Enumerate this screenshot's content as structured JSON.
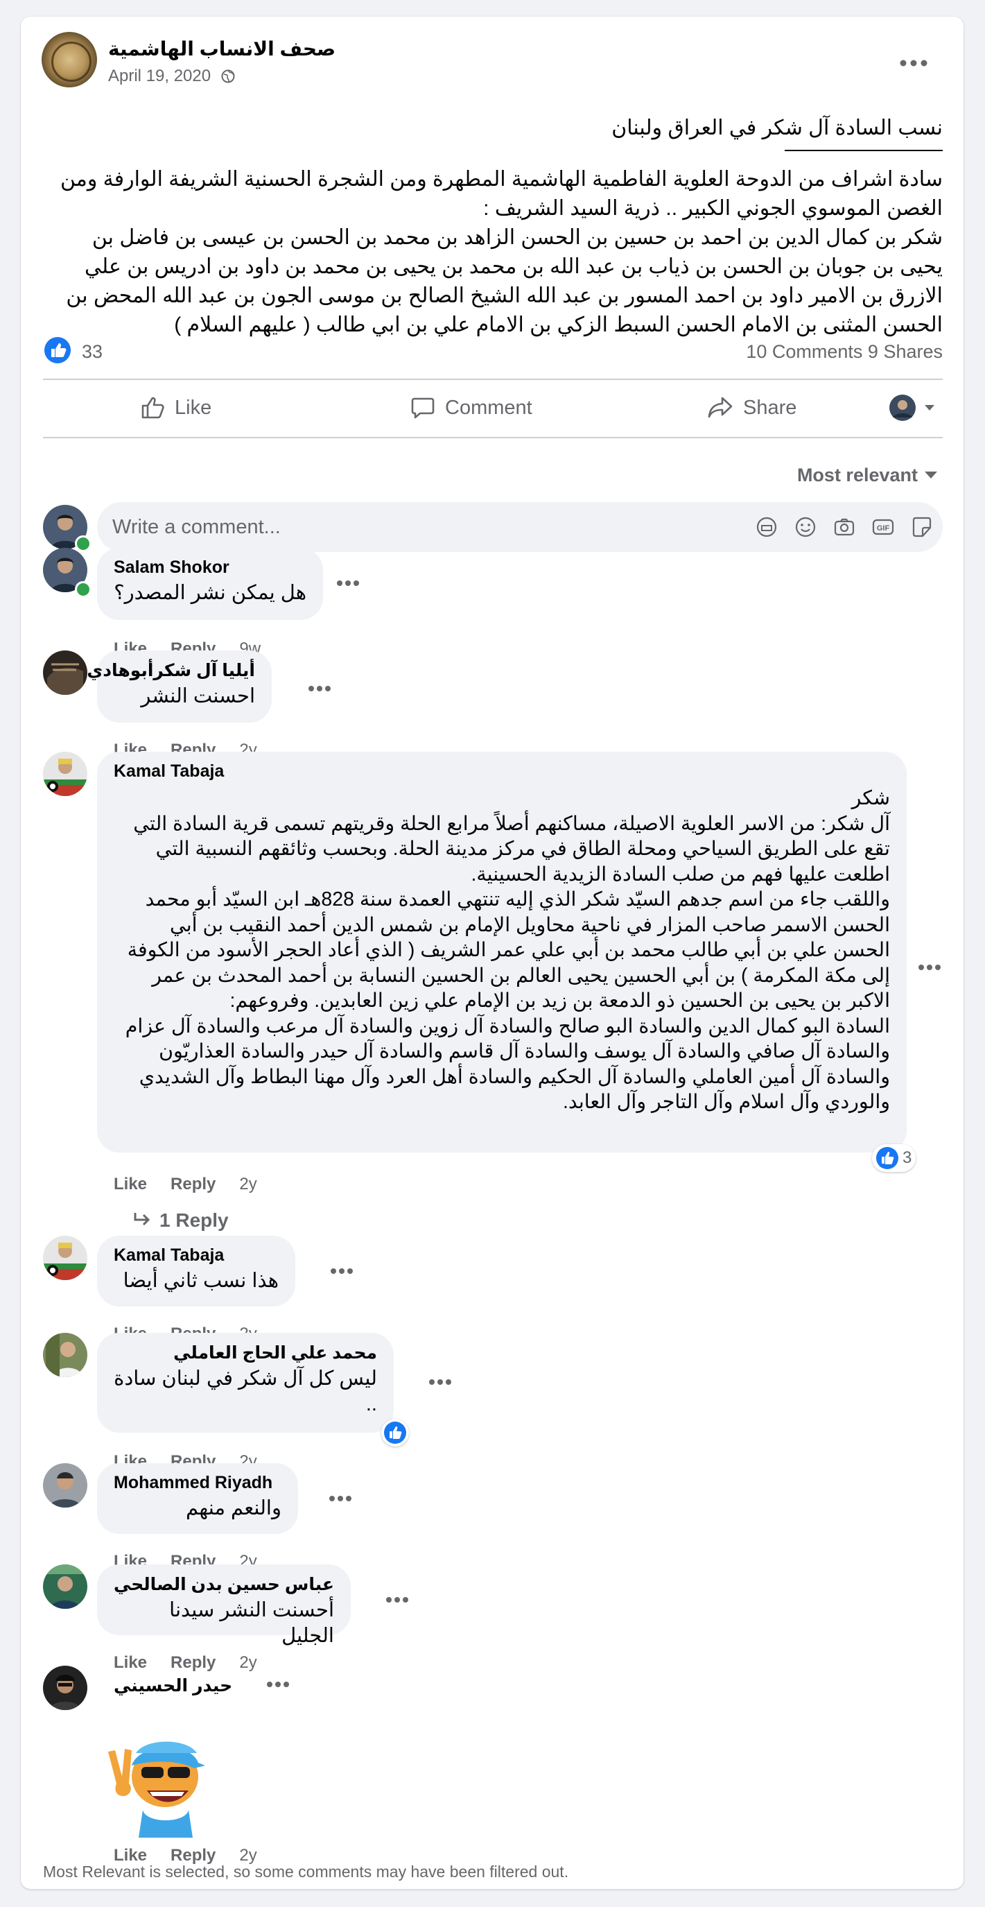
{
  "post": {
    "page_name": "صحف الانساب الهاشمية",
    "date": "April 19, 2020",
    "title": "نسب السادة آل شكر في العراق ولبنان",
    "body": "سادة اشراف من الدوحة العلوية الفاطمية الهاشمية المطهرة ومن الشجرة الحسنية الشريفة الوارفة ومن الغصن الموسوي الجوني الكبير .. ذرية السيد الشريف :\nشكر بن كمال الدين بن احمد بن حسين بن الحسن الزاهد بن محمد بن الحسن بن عيسى بن فاضل بن يحيى بن جوبان بن الحسن بن ذياب بن عبد الله بن محمد بن يحيى بن محمد بن داود بن ادريس بن علي الازرق بن الامير داود بن احمد المسور بن عبد الله الشيخ الصالح بن موسى الجون بن عبد الله المحض بن الحسن المثنى بن الامام الحسن السبط الزكي بن الامام علي بن ابي طالب ( عليهم السلام )",
    "like_count": "33",
    "comments_shares": "10 Comments  9 Shares"
  },
  "actions": {
    "like": "Like",
    "comment": "Comment",
    "share": "Share"
  },
  "sort_label": "Most relevant",
  "composer_placeholder": "Write a comment...",
  "comment_actions": {
    "like": "Like",
    "reply": "Reply"
  },
  "comments": [
    {
      "name": "Salam Shokor",
      "text": "هل يمكن نشر المصدر؟",
      "time": "9w"
    },
    {
      "name": "أيليا آل شكرأبوهادي",
      "text": "احسنت النشر",
      "time": "2y"
    },
    {
      "name": "Kamal Tabaja",
      "text": "شكر\nآل شكر: من الاسر العلوية الاصيلة، مساكنهم أصلاً مرابع الحلة وقريتهم تسمى قرية السادة التي تقع على الطريق السياحي ومحلة الطاق في مركز مدينة الحلة. وبحسب وثائقهم النسبية التي اطلعت عليها فهم من صلب السادة الزيدية الحسينية.\nواللقب جاء من اسم جدهم السيّد شكر الذي إليه تنتهي العمدة سنة 828هـ ابن السيّد أبو محمد الحسن الاسمر صاحب المزار في ناحية محاويل الإمام بن شمس الدين أحمد النقيب بن أبي الحسن علي بن أبي طالب محمد بن أبي علي عمر الشريف ( الذي أعاد الحجر الأسود من الكوفة إلى مكة المكرمة ) بن أبي الحسين يحيى العالم بن الحسين النسابة بن أحمد المحدث بن عمر الاكبر بن يحيى بن الحسين ذو الدمعة بن زيد بن الإمام علي زين العابدين. وفروعهم:\nالسادة البو كمال الدين والسادة البو صالح والسادة آل زوين والسادة آل مرعب والسادة آل عزام والسادة آل صافي والسادة آل يوسف والسادة آل قاسم والسادة آل حيدر والسادة العذاريّون والسادة آل أمين العاملي والسادة آل الحكيم والسادة أهل العرد وآل مهنا البطاط وآل الشديدي والوردي وآل اسلام وآل التاجر وآل العابد.",
      "time": "2y",
      "reactions": "3",
      "replies": "1 Reply"
    },
    {
      "name": "Kamal Tabaja",
      "text": "هذا نسب ثاني أيضا",
      "time": "2y"
    },
    {
      "name": "محمد علي الحاج العاملي",
      "text": "ليس كل آل شكر في لبنان سادة\n..",
      "time": "2y"
    },
    {
      "name": "Mohammed Riyadh",
      "text": "والنعم منهم",
      "time": "2y"
    },
    {
      "name": "عباس حسين بدن الصالحي",
      "text": "أحسنت النشر سيدنا الجليل",
      "time": "2y"
    },
    {
      "name": "حيدر الحسيني",
      "text": "",
      "time": "2y",
      "sticker": "peace-sign-sticker"
    }
  ],
  "footer_note": "Most Relevant is selected, so some comments may have been filtered out.",
  "colors": {
    "facebook_blue": "#1877f2",
    "bubble": "#f0f2f5",
    "muted": "#65676b",
    "online": "#31a24c"
  }
}
